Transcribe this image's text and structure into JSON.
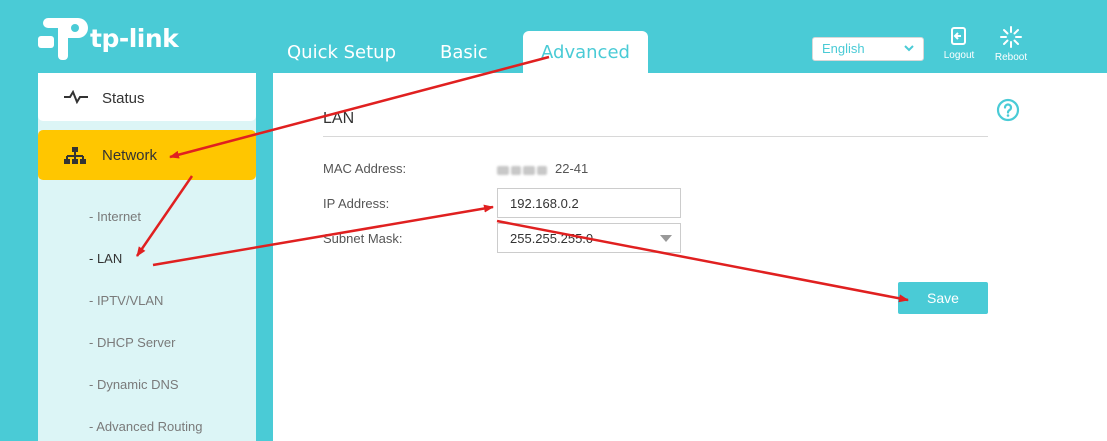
{
  "brand": {
    "name": "tp-link"
  },
  "nav": {
    "tabs": [
      "Quick Setup",
      "Basic",
      "Advanced"
    ],
    "active_tab": "Advanced"
  },
  "header": {
    "language": "English",
    "logout_label": "Logout",
    "reboot_label": "Reboot"
  },
  "sidebar": {
    "status_label": "Status",
    "network_label": "Network",
    "sub_items": [
      "- Internet",
      "- LAN",
      "- IPTV/VLAN",
      "- DHCP Server",
      "- Dynamic DNS",
      "- Advanced Routing"
    ]
  },
  "lan": {
    "title": "LAN",
    "mac_label": "MAC Address:",
    "mac_value_visible": "22-41",
    "ip_label": "IP Address:",
    "ip_value": "192.168.0.2",
    "subnet_label": "Subnet Mask:",
    "subnet_value": "255.255.255.0",
    "save_label": "Save"
  },
  "colors": {
    "accent": "#4acbd6",
    "active_nav": "#ffc600",
    "annotation_arrow": "#e02020"
  }
}
